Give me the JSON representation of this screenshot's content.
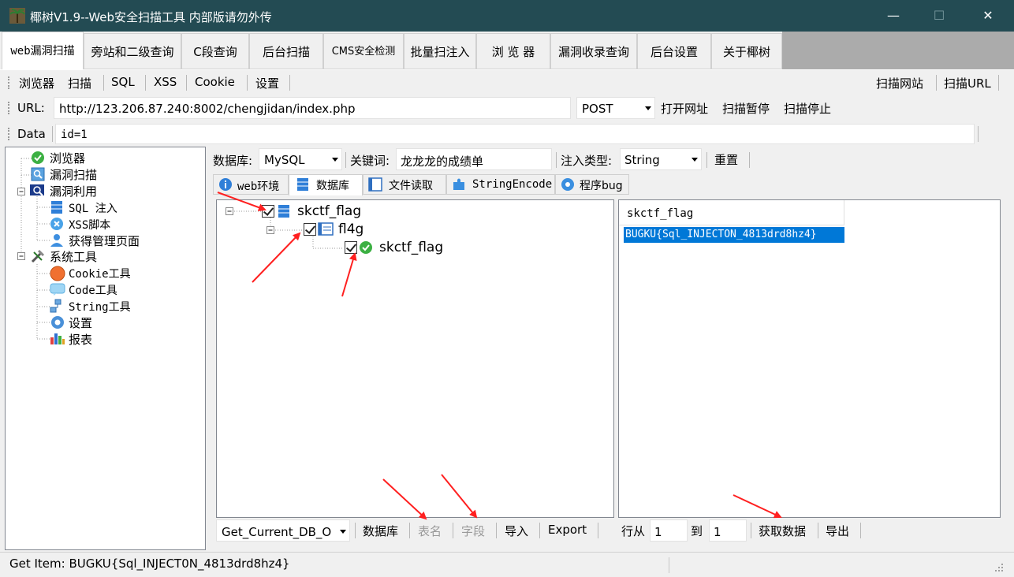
{
  "window": {
    "title": "椰树V1.9--Web安全扫描工具  内部版请勿外传",
    "controls": {
      "minimize": "—",
      "maximize": "☐",
      "close": "✕"
    }
  },
  "main_tabs": [
    {
      "label": "web漏洞扫描",
      "active": true
    },
    {
      "label": "旁站和二级查询"
    },
    {
      "label": "C段查询"
    },
    {
      "label": "后台扫描"
    },
    {
      "label": "CMS安全检测"
    },
    {
      "label": "批量扫注入"
    },
    {
      "label": "浏 览 器"
    },
    {
      "label": "漏洞收录查询"
    },
    {
      "label": "后台设置"
    },
    {
      "label": "关于椰树"
    }
  ],
  "toolbar1": {
    "items": [
      "浏览器",
      "扫描",
      "SQL",
      "XSS",
      "Cookie",
      "设置"
    ],
    "right_items": [
      "扫描网站",
      "扫描URL"
    ]
  },
  "url_bar": {
    "label": "URL:",
    "value": "http://123.206.87.240:8002/chengjidan/index.php",
    "method": "POST",
    "actions": [
      "打开网址",
      "扫描暂停",
      "扫描停止"
    ]
  },
  "data_bar": {
    "label": "Data",
    "value": "id=1"
  },
  "tree": {
    "items": [
      {
        "label": "浏览器",
        "icon": "check-circle-icon"
      },
      {
        "label": "漏洞扫描",
        "icon": "scan-icon"
      },
      {
        "label": "漏洞利用",
        "icon": "exploit-icon"
      },
      {
        "label": "SQL 注入",
        "icon": "database-icon"
      },
      {
        "label": "XSS脚本",
        "icon": "xss-icon"
      },
      {
        "label": "获得管理页面",
        "icon": "user-icon"
      },
      {
        "label": "系统工具",
        "icon": "tools-icon"
      },
      {
        "label": "Cookie工具",
        "icon": "cookie-icon"
      },
      {
        "label": "Code工具",
        "icon": "code-icon"
      },
      {
        "label": "String工具",
        "icon": "string-icon"
      },
      {
        "label": "设置",
        "icon": "gear-icon"
      },
      {
        "label": "报表",
        "icon": "chart-icon"
      }
    ]
  },
  "db_bar": {
    "db_label": "数据库:",
    "db_value": "MySQL",
    "keyword_label": "关键词:",
    "keyword_value": "龙龙龙的成绩单",
    "inject_label": "注入类型:",
    "inject_value": "String",
    "reset": "重置"
  },
  "sub_tabs": [
    {
      "label": "web环境",
      "icon": "info-icon"
    },
    {
      "label": "数据库",
      "icon": "database-icon",
      "active": true
    },
    {
      "label": "文件读取",
      "icon": "file-icon"
    },
    {
      "label": "StringEncode",
      "icon": "puzzle-icon"
    },
    {
      "label": "程序bug",
      "icon": "gear-icon"
    }
  ],
  "db_tree": {
    "database": "skctf_flag",
    "table": "fl4g",
    "column": "skctf_flag"
  },
  "result": {
    "header": "skctf_flag",
    "rows": [
      "BUGKU{Sql_INJECTON_4813drd8hz4}"
    ]
  },
  "bottom_bar": {
    "method_select": "Get_Current_DB_O",
    "buttons": [
      "数据库",
      "表名",
      "字段",
      "导入",
      "Export"
    ],
    "row_from_label": "行从",
    "row_from": "1",
    "row_to_label": "到",
    "row_to": "1",
    "fetch": "获取数据",
    "export": "导出"
  },
  "status": {
    "text": "Get Item: BUGKU{Sql_INJECT0N_4813drd8hz4}"
  },
  "colors": {
    "titlebar": "#234b53",
    "selection": "#0078d7",
    "arrow": "#ff2020"
  }
}
